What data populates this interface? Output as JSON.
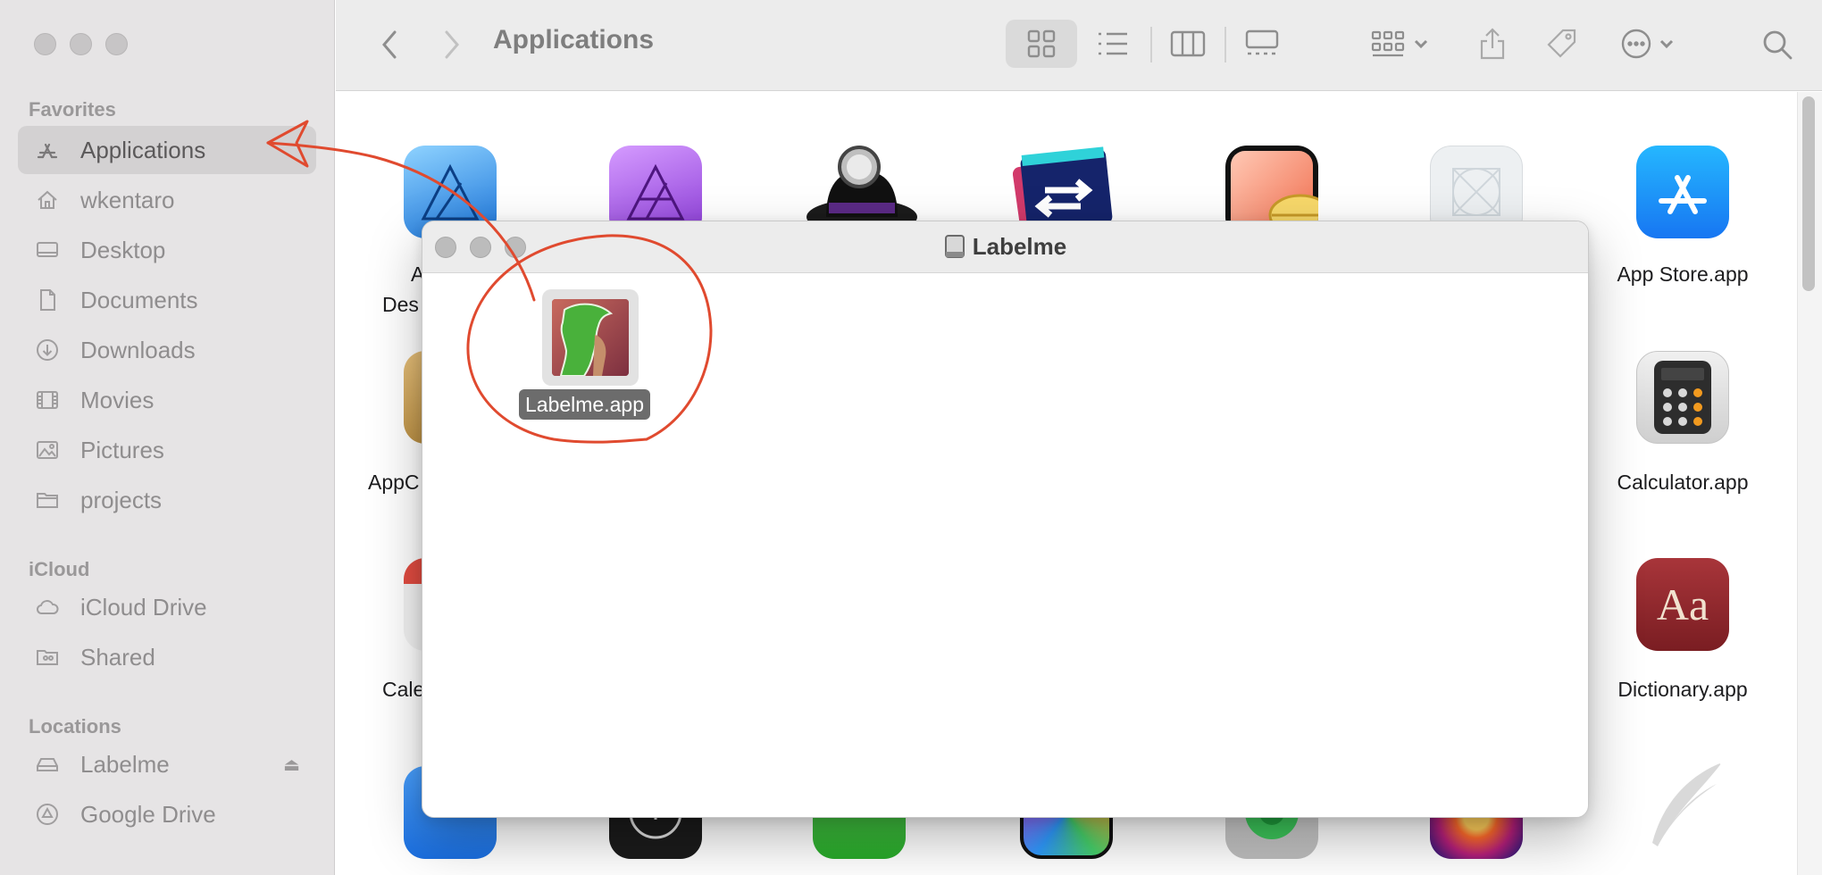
{
  "window": {
    "title": "Applications"
  },
  "sidebar": {
    "favorites_header": "Favorites",
    "favorites": [
      {
        "label": "Applications",
        "icon": "app-store-a-icon",
        "active": true
      },
      {
        "label": "wkentaro",
        "icon": "home-icon"
      },
      {
        "label": "Desktop",
        "icon": "desktop-icon"
      },
      {
        "label": "Documents",
        "icon": "document-icon"
      },
      {
        "label": "Downloads",
        "icon": "download-icon"
      },
      {
        "label": "Movies",
        "icon": "film-icon"
      },
      {
        "label": "Pictures",
        "icon": "photo-icon"
      },
      {
        "label": "projects",
        "icon": "folder-icon"
      }
    ],
    "icloud_header": "iCloud",
    "icloud": [
      {
        "label": "iCloud Drive",
        "icon": "cloud-icon"
      },
      {
        "label": "Shared",
        "icon": "shared-folder-icon"
      }
    ],
    "locations_header": "Locations",
    "locations": [
      {
        "label": "Labelme",
        "icon": "drive-icon",
        "eject": "⏏"
      },
      {
        "label": "Google Drive",
        "icon": "google-drive-icon"
      }
    ]
  },
  "grid": {
    "partial_labels": [
      "A",
      "Des",
      "AppC",
      "Cale"
    ],
    "labels": [
      "App Store.app",
      "Calculator.app",
      "Dictionary.app"
    ]
  },
  "popup": {
    "title": "Labelme",
    "file_label": "Labelme.app"
  },
  "colors": {
    "annotation_red": "#e04a2f",
    "sidebar_bg": "#e6e4e5",
    "toolbar_bg": "#ececec",
    "selection_bg": "#6c6c6c"
  }
}
